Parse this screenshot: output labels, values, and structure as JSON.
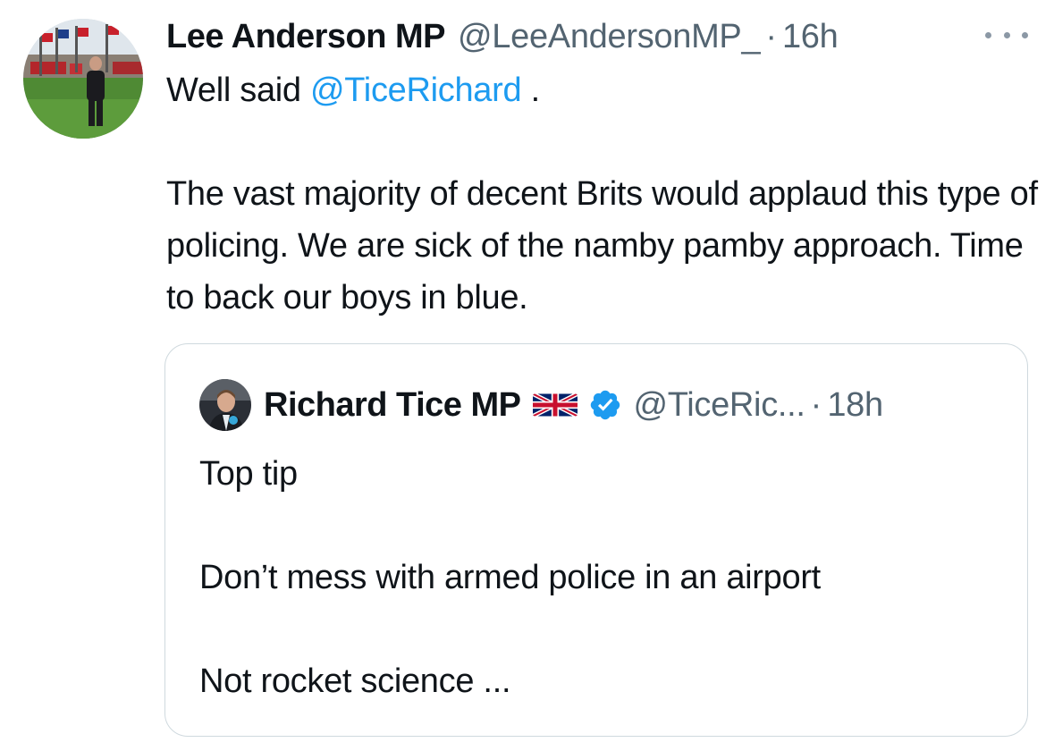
{
  "tweet": {
    "display_name": "Lee Anderson MP",
    "handle": "@LeeAndersonMP_",
    "separator": "·",
    "time": "16h",
    "avatar_icon": "profile-photo-icon",
    "more_icon": "more-options-icon",
    "text_prefix": "Well said ",
    "mention": "@TiceRichard",
    "text_suffix": " .",
    "body": "The vast majority of decent Brits would applaud this type of policing. We are sick of the namby pamby approach. Time to back our boys in blue."
  },
  "quote": {
    "display_name": "Richard Tice MP",
    "flag_icon": "uk-flag-icon",
    "verified_icon": "verified-badge-icon",
    "handle": "@TiceRic...",
    "separator": "·",
    "time": "18h",
    "line1": "Top tip",
    "line2": "Don’t mess with armed police in an airport",
    "line3": "Not rocket science ..."
  },
  "colors": {
    "link": "#1d9bf0",
    "secondary_text": "#536471",
    "primary_text": "#0f1419",
    "border": "#cfd9de",
    "verified": "#1d9bf0"
  }
}
